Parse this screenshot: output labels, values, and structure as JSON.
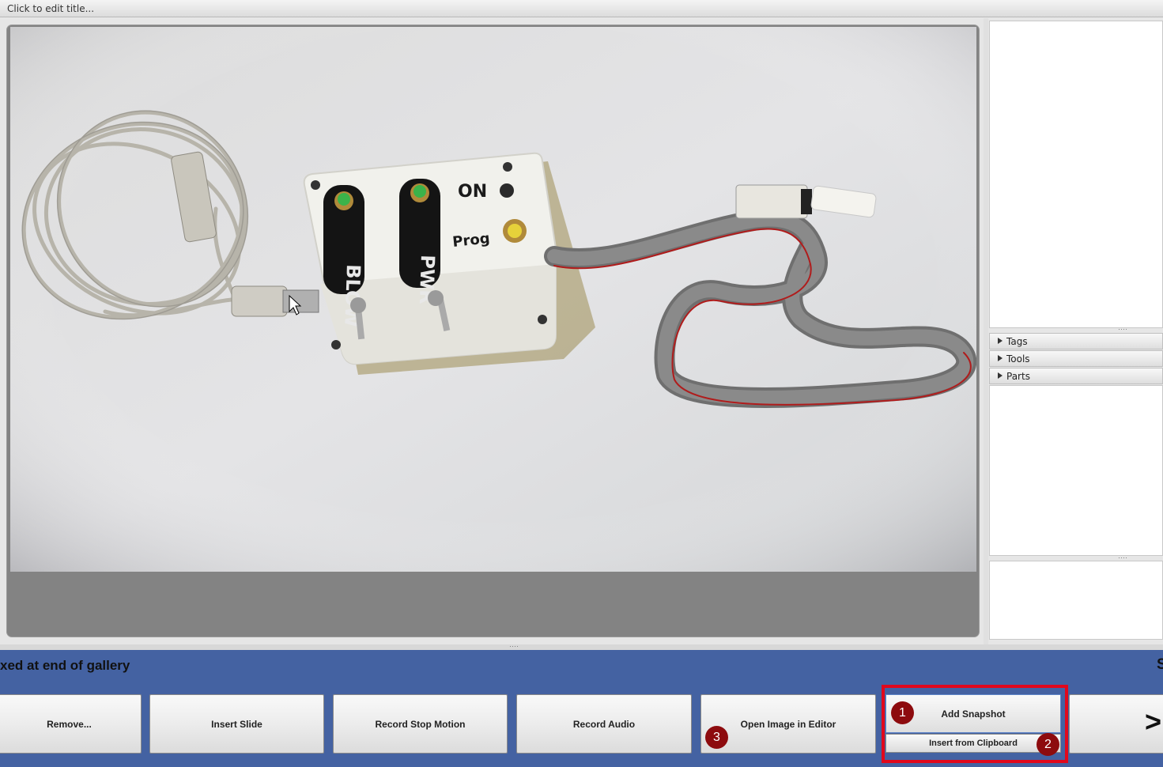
{
  "title": {
    "placeholder": "Click to edit title..."
  },
  "right_panel": {
    "sections": [
      {
        "label": "Tags"
      },
      {
        "label": "Tools"
      },
      {
        "label": "Parts"
      }
    ]
  },
  "gallery": {
    "status_text": "xed at end of gallery",
    "status_right": "S"
  },
  "toolbar": {
    "remove_label": "Remove...",
    "insert_slide_label": "Insert Slide",
    "record_stop_motion_label": "Record Stop Motion",
    "record_audio_label": "Record Audio",
    "open_image_label": "Open Image in Editor",
    "add_snapshot_label": "Add Snapshot",
    "insert_clipboard_label": "Insert from Clipboard",
    "next_label": ">"
  },
  "photo_labels": {
    "switch_1": "BLOW",
    "switch_2": "PWR",
    "on": "ON",
    "prog": "Prog"
  },
  "annotations": [
    "1",
    "2",
    "3"
  ],
  "colors": {
    "highlight": "#e1081c",
    "badge": "#8d0b0e",
    "bottom_bar": "#4462a2"
  }
}
